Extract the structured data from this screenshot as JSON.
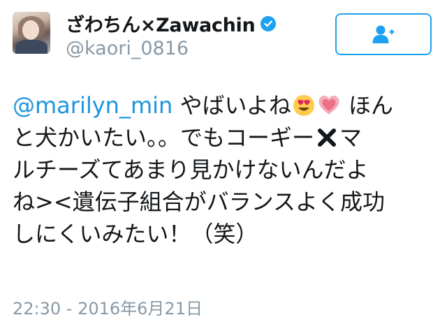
{
  "user": {
    "display_name": "ざわちん×Zawachin",
    "handle": "@kaori_0816",
    "verified": true,
    "avatar_icon": "user-photo-avatar"
  },
  "follow_button": {
    "icon": "follow-add-user-icon",
    "accent_color": "#1da1f2"
  },
  "tweet": {
    "mention": "@marilyn_min",
    "line1_after_mention": " やばいよね",
    "line1_end": " ほん",
    "line2_part1": "と犬かいたい。。でもコーギー",
    "line2_part2": "マ",
    "line3": "ルチーズてあまり見かけないんだよ",
    "line4": "ね><遺伝子組合がバランスよく成功",
    "line5": "しにくいみたい！（笑）",
    "emojis": [
      "heart-eyes-emoji",
      "pink-heart-emoji",
      "multiply-x-emoji"
    ]
  },
  "timestamp": "22:30 - 2016年6月21日",
  "colors": {
    "mention": "#1b95e0",
    "meta_gray": "#8899a6",
    "text": "#14171a"
  }
}
